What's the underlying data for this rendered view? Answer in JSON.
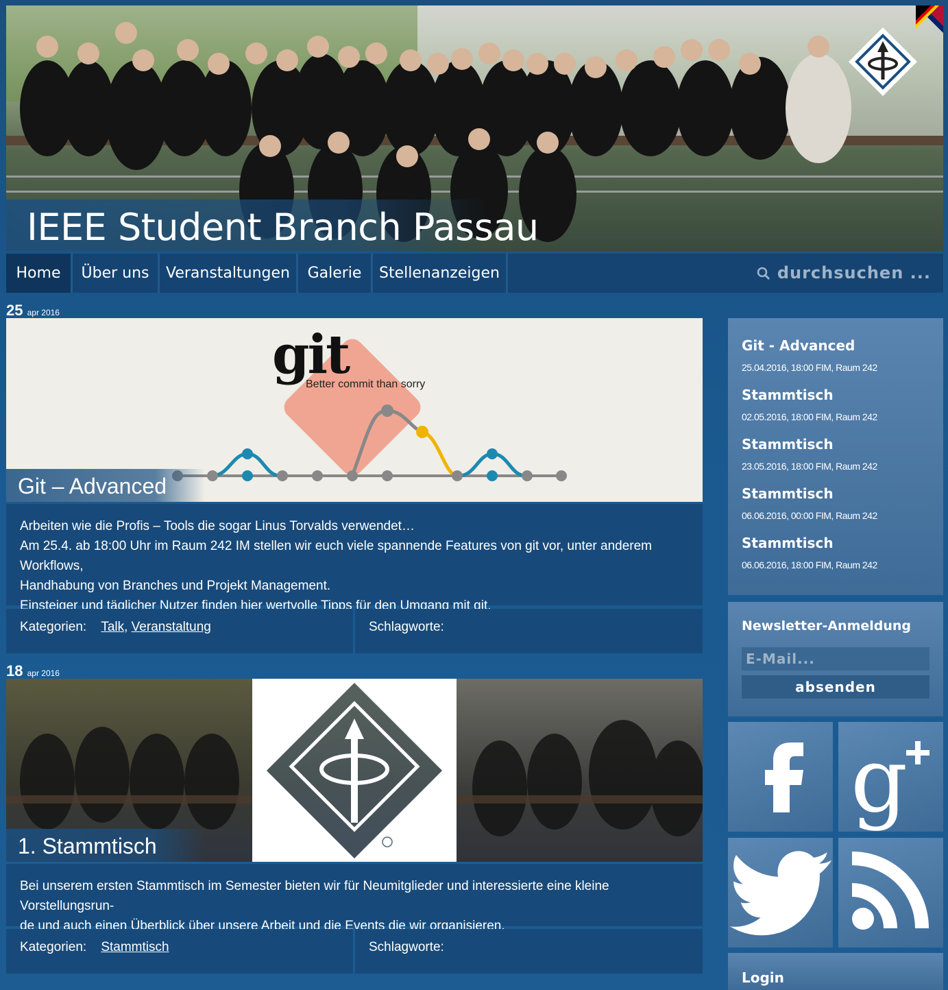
{
  "site": {
    "title": "IEEE Student Branch Passau"
  },
  "nav": {
    "items": [
      {
        "label": "Home",
        "active": true
      },
      {
        "label": "Über uns"
      },
      {
        "label": "Veranstaltungen"
      },
      {
        "label": "Galerie"
      },
      {
        "label": "Stellenanzeigen"
      }
    ],
    "search_placeholder": "durchsuchen ..."
  },
  "posts": [
    {
      "day": "25",
      "month_year": "apr 2016",
      "title": "Git – Advanced",
      "image_text": {
        "logo": "git",
        "tagline": "Better commit than sorry"
      },
      "body": [
        "Arbeiten wie die Profis – Tools die sogar Linus Torvalds verwendet…",
        "Am 25.4. ab 18:00 Uhr im Raum 242 IM stellen wir euch viele spannende Features von git vor, unter anderem Workflows,",
        "Handhabung von Branches und Projekt Management.",
        "Einsteiger und täglicher Nutzer finden hier wertvolle Tipps für den Umgang mit git."
      ],
      "categories_label": "Kategorien:",
      "categories": [
        "Talk",
        "Veranstaltung"
      ],
      "tags_label": "Schlagworte:"
    },
    {
      "day": "18",
      "month_year": "apr 2016",
      "title": "1. Stammtisch",
      "body": [
        "Bei unserem ersten Stammtisch im Semester bieten wir für Neumitglieder und interessierte eine kleine Vorstellungsrun-",
        "de und auch einen Überblick über unsere Arbeit und die Events die wir organisieren."
      ],
      "categories_label": "Kategorien:",
      "categories": [
        "Stammtisch"
      ],
      "tags_label": "Schlagworte:"
    }
  ],
  "events": [
    {
      "title": "Git - Advanced",
      "meta": "25.04.2016, 18:00 FIM, Raum 242"
    },
    {
      "title": "Stammtisch",
      "meta": "02.05.2016, 18:00 FIM, Raum 242"
    },
    {
      "title": "Stammtisch",
      "meta": "23.05.2016, 18:00 FIM, Raum 242"
    },
    {
      "title": "Stammtisch",
      "meta": "06.06.2016, 00:00 FIM, Raum 242"
    },
    {
      "title": "Stammtisch",
      "meta": "06.06.2016, 18:00 FIM, Raum 242"
    }
  ],
  "newsletter": {
    "title": "Newsletter-Anmeldung",
    "placeholder": "E-Mail...",
    "button": "absenden"
  },
  "social": [
    {
      "icon": "facebook-icon"
    },
    {
      "icon": "google-plus-icon"
    },
    {
      "icon": "twitter-icon"
    },
    {
      "icon": "rss-icon"
    }
  ],
  "login": {
    "title": "Login"
  },
  "colors": {
    "background": "#1b4f80",
    "nav": "#154472",
    "sidebar": "#4672a0",
    "git_orange": "#f0a592"
  }
}
